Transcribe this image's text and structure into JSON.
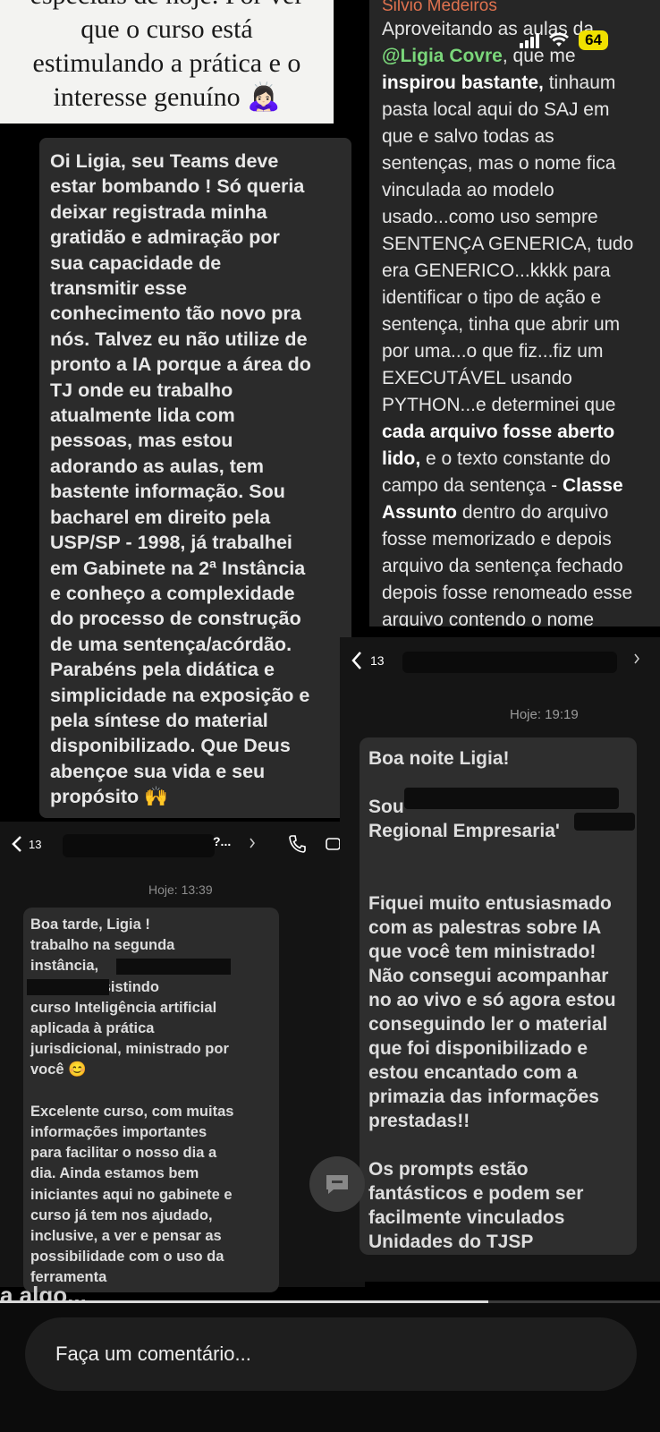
{
  "top_card": {
    "lines": [
      "especiais de hoje. Por ver",
      "que o curso está",
      "estimulando a prática e o",
      "interesse genuíno 🙇🏻‍♀️"
    ]
  },
  "status_bar": {
    "battery": "64"
  },
  "left_card": {
    "text": "Oi Ligia, seu Teams deve\nestar bombando ! Só queria\ndeixar registrada minha\ngratidão e admiração por\nsua capacidade de\ntransmitir esse\nconhecimento tão novo pra\nnós. Talvez eu não utilize de\npronto a IA porque a área do\nTJ onde eu trabalho\natualmente lida com\npessoas, mas estou\nadorando as aulas, tem\nbastente informação. Sou\nbacharel em direito pela\nUSP/SP - 1998, já trabalhei\nem Gabinete na 2ª Instância\ne conheço a complexidade\ndo processo de construção\nde uma sentença/acórdão.\n Parabéns pela didática e\nsimplicidade na exposição e\npela síntese do material\ndisponibilizado. Que Deus\nabençoe sua vida e seu\npropósito 🙌"
  },
  "right_card": {
    "author": "Silvio Medeiros",
    "l1_pre": "Aproveitando as aulas da",
    "mention": "@Ligia Covre",
    "l2_post": ", que me",
    "l3_bold": "inspirou bastante,",
    "l3_post": " tinhaum",
    "l4": "pasta local aqui do SAJ em",
    "l5": "que e salvo todas as",
    "l6": "sentenças, mas o nome fica",
    "l7": "vinculada ao modelo",
    "l8": "usado...como uso sempre",
    "l9": "SENTENÇA GENERICA, tudo",
    "l10": "era GENERICO...kkkk para",
    "l11": "identificar o tipo de ação e",
    "l12": "sentença, tinha que abrir um",
    "l13": "por uma...o que fiz...fiz um",
    "l14": "EXECUTÁVEL usando",
    "l15": "PYTHON...e determinei que",
    "l16_bold": "cada arquivo fosse aberto",
    "l17_bold": "lido,",
    "l17_post": " e  o texto constante do",
    "l18_pre": "campo da sentença - ",
    "l18_bold": "Classe",
    "l19_bold": "Assunto",
    "l19_post": " dentro do arquivo",
    "l20": "fosse memorizado e depois",
    "l21": "arquivo da sentença fechado",
    "l22": "depois fosse renomeado esse",
    "l23": "arquivo contendo o nome"
  },
  "chat_mid": {
    "back_count": "13",
    "time": "Hoje: 19:19",
    "message": "Boa noite Ligia!\n\nSou\nRegional Empresaria'\n\n\nFiquei muito entusiasmado\ncom as palestras sobre IA\nque você tem ministrado!\nNão consegui acompanhar\nno ao vivo e só agora estou\nconseguindo ler o material\nque foi disponibilizado e\nestou encantado com a\nprimazia das informações\nprestadas!!\n\nOs prompts estão\nfantásticos e podem ser\nfacilmente vinculados\nUnidades do TJSP"
  },
  "chat_left": {
    "back_count": "13",
    "name_suffix": "?...",
    "time": "Hoje: 13:39",
    "message": "Boa tarde, Ligia !\ntrabalho na segunda\ninstância,\n                  e estou assistindo\ncurso Inteligência artificial\naplicada à prática\njurisdicional, ministrado por\nvocê 😊\n\nExcelente curso, com muitas\ninformações importantes\npara facilitar o nosso dia a\ndia. Ainda estamos bem\niniciantes aqui no gabinete e\ncurso já tem nos ajudado,\ninclusive, a ver e pensar as\npossibilidade com o uso da\nferramenta"
  },
  "partial_bottom_text": "a algo...",
  "story_progress": 0.74,
  "comment": {
    "placeholder": "Faça um comentário..."
  }
}
